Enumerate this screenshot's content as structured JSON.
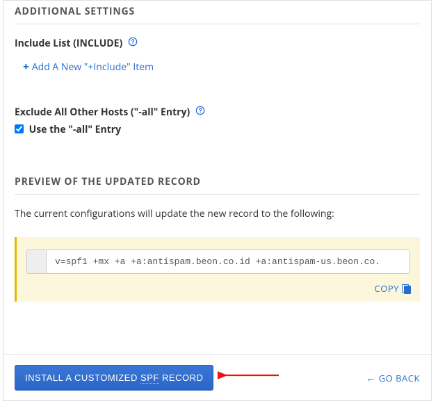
{
  "additional": {
    "heading": "ADDITIONAL SETTINGS",
    "include_label": "Include List (INCLUDE)",
    "add_include_label": "Add A New \"+Include\" Item",
    "exclude_label": "Exclude All Other Hosts (\"-all\" Entry)",
    "use_all_label": "Use the \"-all\" Entry",
    "use_all_checked": true
  },
  "preview": {
    "heading": "PREVIEW OF THE UPDATED RECORD",
    "intro": "The current configurations will update the new record to the following:",
    "record": "v=spf1 +mx +a +a:antispam.beon.co.id +a:antispam-us.beon.co.",
    "copy_label": "COPY"
  },
  "footer": {
    "install_btn_prefix": "INSTALL A CUSTOMIZED ",
    "install_btn_term": "SPF",
    "install_btn_suffix": " RECORD",
    "go_back": "GO BACK"
  }
}
